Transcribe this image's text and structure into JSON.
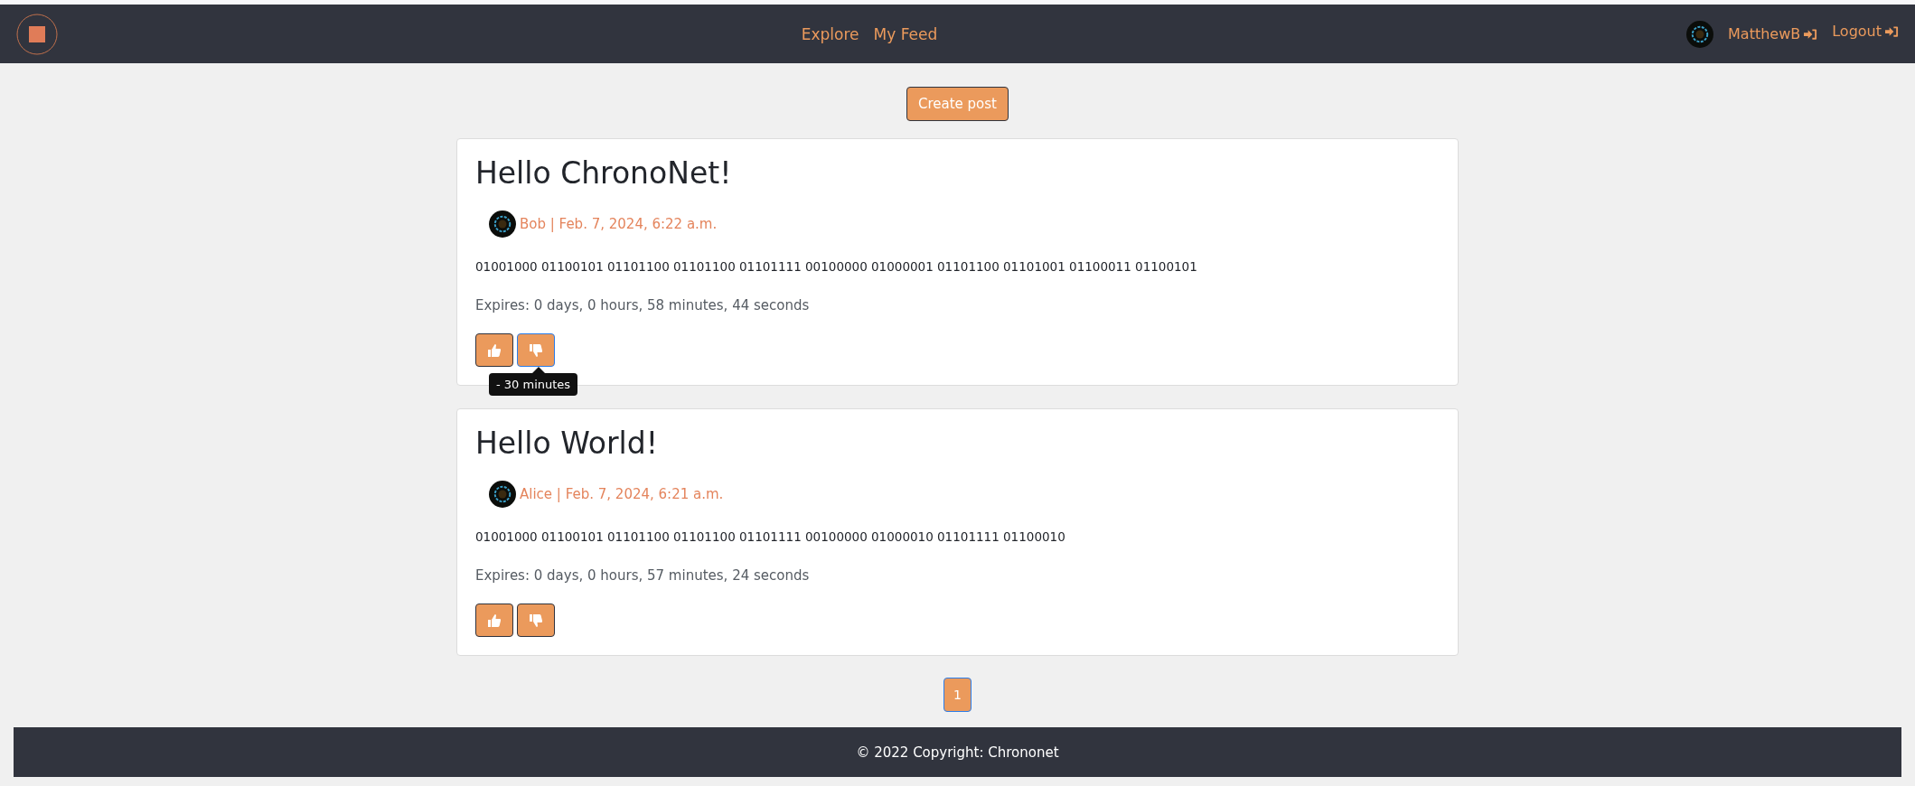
{
  "navbar": {
    "links": [
      {
        "label": "Explore"
      },
      {
        "label": "My Feed"
      }
    ],
    "user": {
      "name": "MatthewB"
    },
    "logout": {
      "label": "Logout"
    }
  },
  "create_button": {
    "label": "Create post"
  },
  "posts": [
    {
      "title": "Hello ChronoNet!",
      "meta": "Bob | Feb. 7, 2024, 6:22 a.m.",
      "body": "01001000 01100101 01101100 01101100 01101111 00100000 01000001 01101100 01101001 01100011 01100101",
      "expires": "Expires: 0 days, 0 hours, 58 minutes, 44 seconds",
      "tooltip": "- 30 minutes"
    },
    {
      "title": "Hello World!",
      "meta": "Alice | Feb. 7, 2024, 6:21 a.m.",
      "body": "01001000 01100101 01101100 01101100 01101111 00100000 01000010 01101111 01100010",
      "expires": "Expires: 0 days, 0 hours, 57 minutes, 24 seconds"
    }
  ],
  "pagination": [
    {
      "label": "1",
      "selected": true
    }
  ],
  "footer": {
    "text": "© 2022 Copyright: Chrononet"
  }
}
